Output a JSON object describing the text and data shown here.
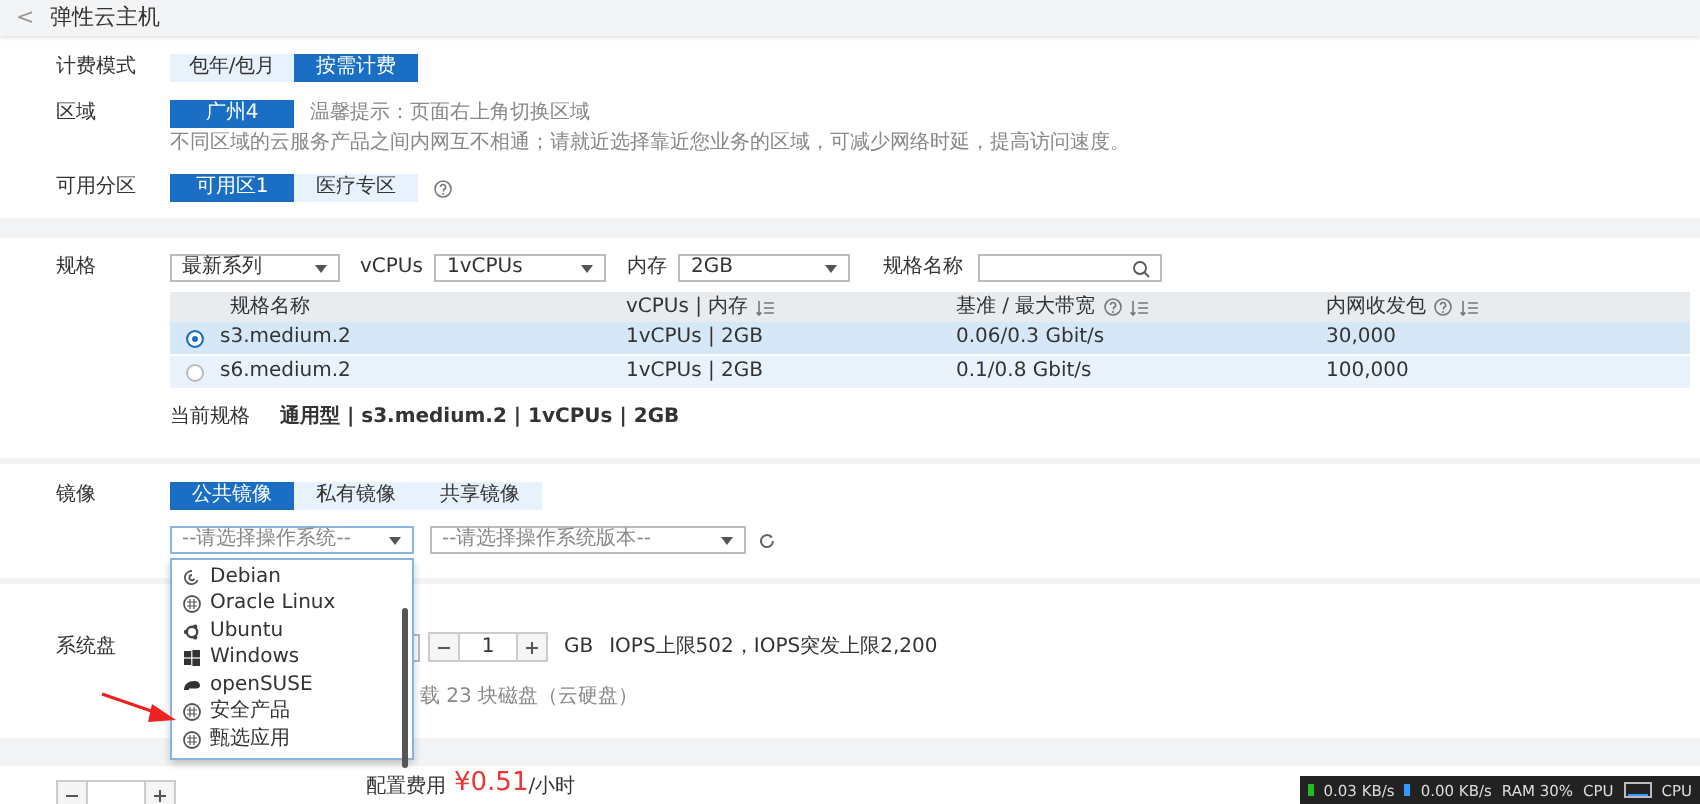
{
  "header": {
    "back": "<",
    "title": "弹性云主机"
  },
  "billing": {
    "label": "计费模式",
    "options": [
      {
        "label": "包年/包月",
        "selected": false
      },
      {
        "label": "按需计费",
        "selected": true
      }
    ]
  },
  "region": {
    "label": "区域",
    "options": [
      {
        "label": "广州4",
        "selected": true
      }
    ],
    "tip": "温馨提示：页面右上角切换区域",
    "note": "不同区域的云服务产品之间内网互不相通；请就近选择靠近您业务的区域，可减少网络时延，提高访问速度。"
  },
  "az": {
    "label": "可用分区",
    "options": [
      {
        "label": "可用区1",
        "selected": true
      },
      {
        "label": "医疗专区",
        "selected": false
      }
    ]
  },
  "spec": {
    "label": "规格",
    "filters": [
      {
        "value": "最新系列"
      },
      {
        "label": "vCPUs",
        "value": "1vCPUs"
      },
      {
        "label": "内存",
        "value": "2GB"
      }
    ],
    "search_label": "规格名称",
    "columns": [
      {
        "title": "规格名称",
        "kind": "plain"
      },
      {
        "title": "vCPUs | 内存",
        "kind": "sortable"
      },
      {
        "title": "基准 / 最大带宽",
        "kind": "help_sortable"
      },
      {
        "title": "内网收发包",
        "kind": "help_sortable"
      }
    ],
    "rows": [
      {
        "selected": true,
        "cells": [
          "s3.medium.2",
          "1vCPUs | 2GB",
          "0.06/0.3 Gbit/s",
          "30,000"
        ]
      },
      {
        "selected": false,
        "cells": [
          "s6.medium.2",
          "1vCPUs | 2GB",
          "0.1/0.8 Gbit/s",
          "100,000"
        ]
      }
    ],
    "current_label": "当前规格",
    "current_value": "通用型 | s3.medium.2 | 1vCPUs | 2GB"
  },
  "image": {
    "label": "镜像",
    "tabs": [
      {
        "label": "公共镜像",
        "selected": true
      },
      {
        "label": "私有镜像",
        "selected": false
      },
      {
        "label": "共享镜像",
        "selected": false
      }
    ],
    "os_select": {
      "placeholder": "--请选择操作系统--",
      "expanded": true
    },
    "version_select": {
      "placeholder": "--请选择操作系统版本--"
    },
    "os_options": [
      {
        "label": "Debian",
        "kind": "debian"
      },
      {
        "label": "Oracle Linux",
        "kind": "generic"
      },
      {
        "label": "Ubuntu",
        "kind": "ubuntu"
      },
      {
        "label": "Windows",
        "kind": "windows"
      },
      {
        "label": "openSUSE",
        "kind": "suse"
      },
      {
        "label": "安全产品",
        "kind": "generic"
      },
      {
        "label": "甄选应用",
        "kind": "generic"
      }
    ]
  },
  "disk": {
    "label": "系统盘",
    "size": "1",
    "unit": "GB",
    "iops": "IOPS上限502，IOPS突发上限2,200",
    "note": "载 23 块磁盘（云硬盘）"
  },
  "footer": {
    "price_label": "配置费用",
    "price": "¥0.51",
    "price_unit": "/小时"
  },
  "taskbar": {
    "upload": "0.03 KB/s",
    "download": "0.00 KB/s",
    "ram": "RAM 30%",
    "cpu_graph_label": "CPU",
    "cpu_label": "CPU"
  }
}
